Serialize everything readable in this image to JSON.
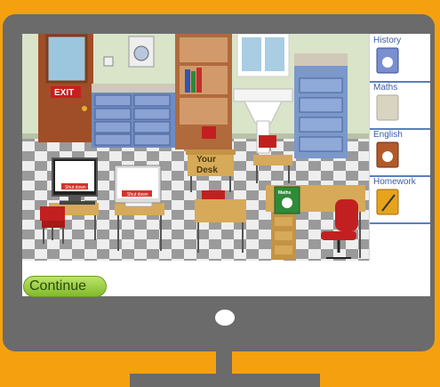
{
  "scene": {
    "exit_sign": "EXIT",
    "your_desk_line1": "Your",
    "your_desk_line2": "Desk",
    "computer1_label": "Shut down",
    "computer2_label": "Shut down",
    "desk_book_label": "Maths"
  },
  "sidebar": {
    "items": [
      {
        "label": "History",
        "book_color": "#7a8fd0",
        "book_label": "History"
      },
      {
        "label": "Maths",
        "book_color": "#d9d4c2",
        "book_label": ""
      },
      {
        "label": "English",
        "book_color": "#b35a2a",
        "book_label": "English"
      },
      {
        "label": "Homework",
        "book_color": "#e7a31a",
        "book_label": "Homework"
      }
    ]
  },
  "continue_label": "Continue",
  "colors": {
    "frame": "#f5a10f",
    "monitor": "#6b6b6b",
    "wall": "#d8e3c8",
    "sidebar_divider": "#5a7fc0",
    "continue_button": "#9acd3c"
  }
}
